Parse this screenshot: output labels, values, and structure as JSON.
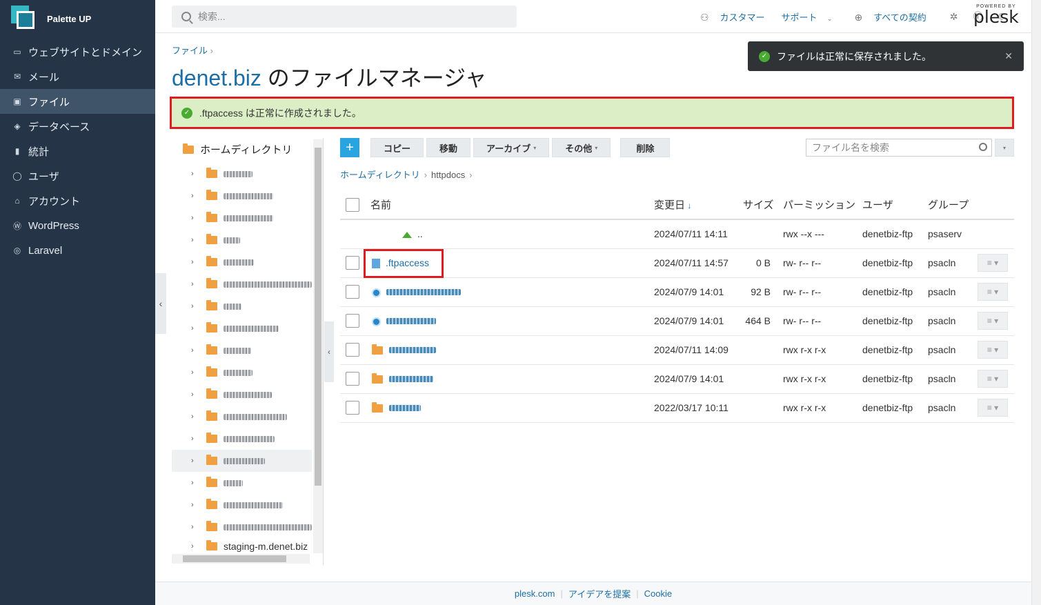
{
  "app": {
    "brand": "Palette UP"
  },
  "sidebar": {
    "items": [
      {
        "label": "ウェブサイトとドメイン",
        "icon": "monitor-icon"
      },
      {
        "label": "メール",
        "icon": "mail-icon"
      },
      {
        "label": "ファイル",
        "icon": "folder-icon",
        "active": true
      },
      {
        "label": "データベース",
        "icon": "database-icon"
      },
      {
        "label": "統計",
        "icon": "chart-icon"
      },
      {
        "label": "ユーザ",
        "icon": "user-icon"
      },
      {
        "label": "アカウント",
        "icon": "account-icon"
      },
      {
        "label": "WordPress",
        "icon": "wordpress-icon"
      },
      {
        "label": "Laravel",
        "icon": "laravel-icon"
      }
    ]
  },
  "topbar": {
    "search_placeholder": "検索...",
    "customer": "カスタマー",
    "support": "サポート",
    "subscriptions": "すべての契約",
    "plesk_powered": "POWERED BY",
    "plesk_logo": "plesk"
  },
  "breadcrumb_top": "ファイル",
  "title": {
    "domain": "denet.biz",
    "rest": " のファイルマネージャ"
  },
  "success_message": ".ftpaccess は正常に作成されました。",
  "toast_message": "ファイルは正常に保存されました。",
  "tree": {
    "root": "ホームディレクトリ",
    "last_item": "staging-m.denet.biz"
  },
  "toolbar": {
    "add": "+",
    "copy": "コピー",
    "move": "移動",
    "archive": "アーカイブ",
    "other": "その他",
    "delete": "削除",
    "search_placeholder": "ファイル名を検索"
  },
  "path": {
    "root": "ホームディレクトリ",
    "current": "httpdocs"
  },
  "table": {
    "headers": {
      "name": "名前",
      "modified": "変更日",
      "size": "サイズ",
      "permission": "パーミッション",
      "user": "ユーザ",
      "group": "グループ"
    },
    "rows": [
      {
        "name": "..",
        "modified": "2024/07/11 14:11",
        "size": "",
        "perm": "rwx --x ---",
        "user": "denetbiz-ftp",
        "group": "psaserv"
      },
      {
        "name": ".ftpaccess",
        "modified": "2024/07/11 14:57",
        "size": "0 B",
        "perm": "rw- r-- r--",
        "user": "denetbiz-ftp",
        "group": "psacln"
      },
      {
        "name": "",
        "modified": "2024/07/9 14:01",
        "size": "92 B",
        "perm": "rw- r-- r--",
        "user": "denetbiz-ftp",
        "group": "psacln"
      },
      {
        "name": "",
        "modified": "2024/07/9 14:01",
        "size": "464 B",
        "perm": "rw- r-- r--",
        "user": "denetbiz-ftp",
        "group": "psacln"
      },
      {
        "name": "",
        "modified": "2024/07/11 14:09",
        "size": "",
        "perm": "rwx r-x r-x",
        "user": "denetbiz-ftp",
        "group": "psacln"
      },
      {
        "name": "",
        "modified": "2024/07/9 14:01",
        "size": "",
        "perm": "rwx r-x r-x",
        "user": "denetbiz-ftp",
        "group": "psacln"
      },
      {
        "name": "",
        "modified": "2022/03/17 10:11",
        "size": "",
        "perm": "rwx r-x r-x",
        "user": "denetbiz-ftp",
        "group": "psacln"
      }
    ]
  },
  "footer": {
    "link1": "plesk.com",
    "link2": "アイデアを提案",
    "link3": "Cookie"
  },
  "colors": {
    "sidebar": "#253447",
    "accent": "#1c6ea4",
    "success_bg": "#dbeec6",
    "highlight": "#e01c23"
  }
}
